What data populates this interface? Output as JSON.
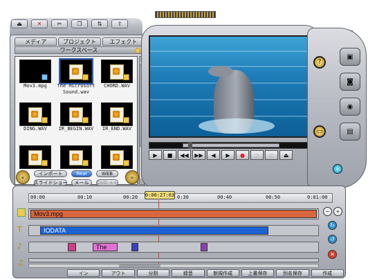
{
  "toolbar": {
    "icons": [
      "eject-icon",
      "close-icon",
      "cut-icon",
      "copy-icon",
      "sort-icon",
      "export-icon"
    ]
  },
  "left_panel": {
    "tabs": [
      "メディア",
      "プロジェクト",
      "エフェクト"
    ],
    "workspace_label": "ワークスペース",
    "files": [
      {
        "name": "Mov3.mpg",
        "type": "video"
      },
      {
        "name": "The Microsoft Sound.wav",
        "type": "audio"
      },
      {
        "name": "CHORD.WAV",
        "type": "audio"
      },
      {
        "name": "DING.WAV",
        "type": "audio"
      },
      {
        "name": "IR_BEGIN.WAV",
        "type": "audio"
      },
      {
        "name": "IR_END.WAV",
        "type": "audio"
      },
      {
        "name": "",
        "type": "audio"
      },
      {
        "name": "",
        "type": "audio"
      },
      {
        "name": "",
        "type": "audio"
      }
    ],
    "pills": {
      "import": "インポート",
      "real": "Real",
      "web": "WEB",
      "slideshow": "スライドショー",
      "mail": "メール",
      "dvd": "DVD ++"
    }
  },
  "preview": {
    "transport": [
      "play",
      "stop",
      "rewind",
      "fast-forward",
      "prev-frame",
      "next-frame",
      "record",
      "mark-in",
      "mark-out",
      "eject"
    ]
  },
  "timeline": {
    "timecode": "0:00:27:03",
    "ruler_labels": [
      "00:00",
      "00:10",
      "00:20",
      "0:30",
      "00:40",
      "00:50",
      "0:01:00"
    ],
    "tracks": {
      "video_clip": "Mov3.mpg",
      "title_clip": "IODATA",
      "text_clip": "The"
    },
    "buttons": [
      "イン",
      "アウト",
      "分割",
      "録音",
      "新規作成",
      "上書保存",
      "別名保存",
      "作成"
    ]
  },
  "colors": {
    "video_clip": "#d9663f",
    "title_clip": "#1d62d3",
    "text_clip": "#e171d4",
    "magenta_marker": "#cf3f86",
    "blue_marker": "#3b3fc6",
    "purple_marker": "#8b3fb5",
    "playhead": "#e03a2a",
    "timecode_bg": "#f3dd7a"
  }
}
